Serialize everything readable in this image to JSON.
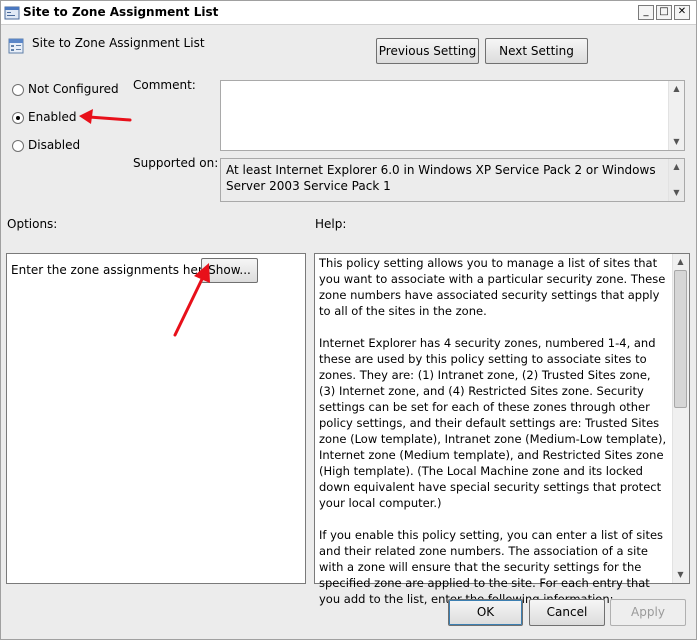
{
  "window": {
    "title": "Site to Zone Assignment List",
    "controls": {
      "minimize": "_",
      "maximize": "□",
      "close": "✕"
    }
  },
  "header": {
    "policy_title": "Site to Zone Assignment List",
    "previous_label": "Previous Setting",
    "next_label": "Next Setting"
  },
  "state": {
    "options": [
      {
        "label": "Not Configured",
        "checked": false
      },
      {
        "label": "Enabled",
        "checked": true
      },
      {
        "label": "Disabled",
        "checked": false
      }
    ]
  },
  "comment": {
    "label": "Comment:",
    "value": ""
  },
  "supported": {
    "label": "Supported on:",
    "value": "At least Internet Explorer 6.0 in Windows XP Service Pack 2 or Windows Server 2003 Service Pack 1"
  },
  "options_panel": {
    "label": "Options:",
    "zone_text": "Enter the zone assignments here.",
    "show_label": "Show..."
  },
  "help": {
    "label": "Help:",
    "paragraphs": [
      "This policy setting allows you to manage a list of sites that you want to associate with a particular security zone. These zone numbers have associated security settings that apply to all of the sites in the zone.",
      "Internet Explorer has 4 security zones, numbered 1-4, and these are used by this policy setting to associate sites to zones. They are: (1) Intranet zone, (2) Trusted Sites zone, (3) Internet zone, and (4) Restricted Sites zone. Security settings can be set for each of these zones through other policy settings, and their default settings are: Trusted Sites zone (Low template), Intranet zone (Medium-Low template), Internet zone (Medium template), and Restricted Sites zone (High template). (The Local Machine zone and its locked down equivalent have special security settings that protect your local computer.)",
      "If you enable this policy setting, you can enter a list of sites and their related zone numbers. The association of a site with a zone will ensure that the security settings for the specified zone are applied to the site.  For each entry that you add to the list, enter the following information:"
    ]
  },
  "footer": {
    "ok_label": "OK",
    "cancel_label": "Cancel",
    "apply_label": "Apply"
  },
  "colors": {
    "annotation_arrow": "#e8101a",
    "window_bg": "#ececec"
  }
}
